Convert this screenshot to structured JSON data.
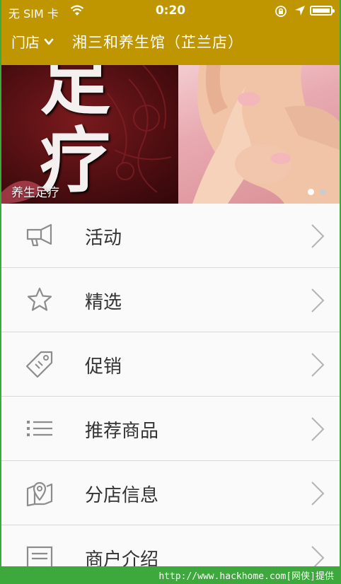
{
  "status_bar": {
    "carrier": "无 SIM 卡",
    "time": "0:20"
  },
  "nav": {
    "store_label": "门店",
    "store_name": "湘三和养生馆（芷兰店）"
  },
  "banner": {
    "caption": "养生足疗",
    "art_text": "足疗",
    "slide_count": 2,
    "active_slide": 1
  },
  "menu": [
    {
      "label": "活动",
      "icon": "megaphone-icon"
    },
    {
      "label": "精选",
      "icon": "star-icon"
    },
    {
      "label": "促销",
      "icon": "tag-icon"
    },
    {
      "label": "推荐商品",
      "icon": "list-icon"
    },
    {
      "label": "分店信息",
      "icon": "map-pin-icon"
    },
    {
      "label": "商户介绍",
      "icon": "document-icon"
    }
  ],
  "watermark": "http://www.hackhome.com[网侠]提供",
  "colors": {
    "header_bg": "#bf9500",
    "frame_green": "#3da93d",
    "text": "#333333",
    "icon_gray": "#8c8c8c"
  }
}
